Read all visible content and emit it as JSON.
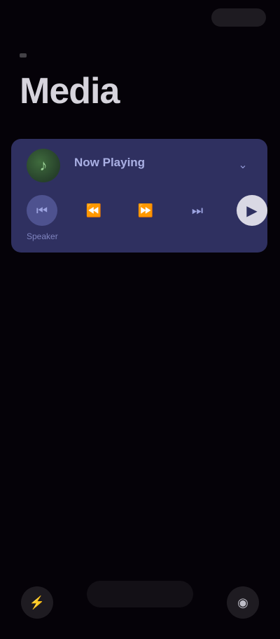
{
  "header": {
    "title": "Media"
  },
  "media_card": {
    "app_icon": "music-note-icon",
    "track_title": "Now Playing",
    "caption": "Speaker",
    "controls": [
      {
        "name": "previous",
        "glyph": "⏮"
      },
      {
        "name": "rewind",
        "glyph": "⏪"
      },
      {
        "name": "forward",
        "glyph": "⏩"
      },
      {
        "name": "next",
        "glyph": "⏭"
      },
      {
        "name": "play",
        "glyph": "▶"
      }
    ],
    "colors": {
      "card_bg": "#2f3060",
      "accent": "#aab0e4"
    }
  },
  "dock": {
    "left_icon": "flashlight-icon",
    "center_label": "",
    "right_icon": "camera-icon"
  }
}
